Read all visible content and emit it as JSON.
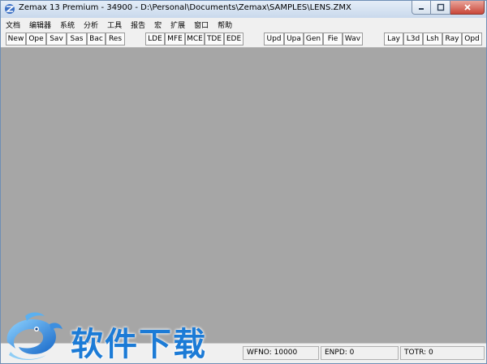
{
  "window": {
    "title": "Zemax 13 Premium - 34900 - D:\\Personal\\Documents\\Zemax\\SAMPLES\\LENS.ZMX"
  },
  "window_controls": {
    "minimize": "minimize-icon",
    "maximize": "maximize-icon",
    "close": "close-icon"
  },
  "menu": [
    "文档",
    "编辑器",
    "系统",
    "分析",
    "工具",
    "报告",
    "宏",
    "扩展",
    "窗口",
    "帮助"
  ],
  "toolbar": {
    "group1": [
      "New",
      "Ope",
      "Sav",
      "Sas",
      "Bac",
      "Res"
    ],
    "group2": [
      "LDE",
      "MFE",
      "MCE",
      "TDE",
      "EDE"
    ],
    "group3": [
      "Upd",
      "Upa",
      "Gen",
      "Fie",
      "Wav"
    ],
    "group4": [
      "Lay",
      "L3d",
      "Lsh",
      "Ray",
      "Opd"
    ]
  },
  "status": {
    "wfno": "WFNO: 10000",
    "enpd": "ENPD: 0",
    "totr": "TOTR: 0"
  },
  "watermark": {
    "text": "软件下载"
  },
  "colors": {
    "workspace": "#a6a6a6",
    "watermark_blue": "#1c7bd6"
  }
}
